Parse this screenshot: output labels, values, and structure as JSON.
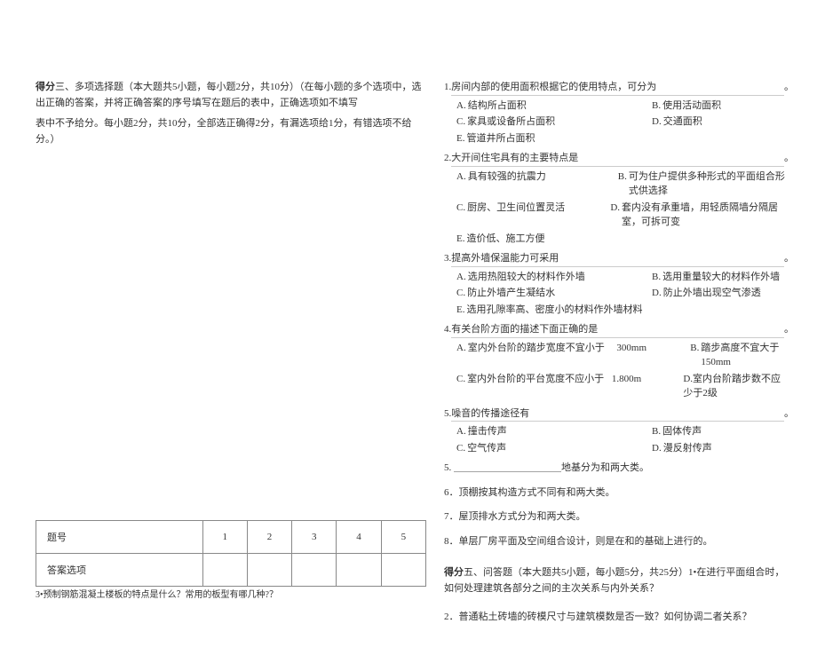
{
  "leftSection": {
    "titlePrefix": "得分",
    "titleRest": "三、多项选择题（本大题共5小题，每小题2分，共10分）（在每小题的多个选项中，选出正确的答案，并将正确答案的序号填写在题后的表中，正确选项如不填写",
    "note": "表中不予给分。每小题2分，共10分，全部选正确得2分，有漏选项给1分，有错选项不给分。）",
    "tableHeader": "题号",
    "cols": [
      "1",
      "2",
      "3",
      "4",
      "5"
    ],
    "tableRowLabel": "答案选项",
    "footnote": "3•预制钢筋混凝土楼板的特点是什么？常用的板型有哪几种?？"
  },
  "questions": [
    {
      "num": "1.",
      "text": "房间内部的使用面积根据它的使用特点，可分为",
      "tail": "。",
      "rows": [
        [
          {
            "l": "A.",
            "t": "结构所占面积",
            "w": "w1"
          },
          {
            "l": "B.",
            "t": "使用活动面积",
            "w": "w3"
          }
        ],
        [
          {
            "l": "C.",
            "t": "家具或设备所占面积",
            "w": "w1"
          },
          {
            "l": "D.",
            "t": "交通面积",
            "w": "w3"
          }
        ],
        [
          {
            "l": "E.",
            "t": "管道井所占面积",
            "w": "w1"
          }
        ]
      ]
    },
    {
      "num": "2.",
      "text": "大开间住宅具有的主要特点是",
      "tail": "。",
      "rows": [
        [
          {
            "l": "A.",
            "t": "具有较强的抗震力",
            "w": "w1"
          },
          {
            "l": "B.",
            "t": "可为住户提供多种形式的平面组合形式供选择",
            "w": ""
          }
        ],
        [
          {
            "l": "C.",
            "t": "厨房、卫生间位置灵活",
            "w": "w1"
          },
          {
            "l": "D.",
            "t": "套内没有承重墙，用轻质隔墙分隔居室，可拆可变",
            "w": ""
          }
        ],
        [
          {
            "l": "E.",
            "t": "造价低、施工方便",
            "w": "w1"
          }
        ]
      ]
    },
    {
      "num": "3.",
      "text": "提高外墙保温能力可采用",
      "tail": "。",
      "rows": [
        [
          {
            "l": "A.",
            "t": "选用热阻较大的材料作外墙",
            "w": "w1"
          },
          {
            "l": "B.",
            "t": "选用重量较大的材料作外墙",
            "w": ""
          }
        ],
        [
          {
            "l": "C.",
            "t": "防止外墙产生凝结水",
            "w": "w1"
          },
          {
            "l": "D.",
            "t": "防止外墙出现空气渗透",
            "w": ""
          }
        ],
        [
          {
            "l": "E.",
            "t": "选用孔隙率高、密度小的材料作外墙材料",
            "w": ""
          }
        ]
      ]
    },
    {
      "num": "4.",
      "text": "有关台阶方面的描述下面正确的是",
      "tail": "。",
      "rows": [
        [
          {
            "l": "A.",
            "t": "室内外台阶的踏步宽度不宜小于",
            "w": "w1"
          },
          {
            "l": "",
            "t": "300mm",
            "w": "w2"
          },
          {
            "l": "B.",
            "t": "踏步高度不宜大于150mm",
            "w": ""
          }
        ],
        [
          {
            "l": "C.",
            "t": "室内外台阶的平台宽度不应小于",
            "w": "w1"
          },
          {
            "l": "",
            "t": "1.800m",
            "w": "w2"
          },
          {
            "l": "",
            "t": "D.室内台阶踏步数不应少于2级",
            "w": ""
          }
        ]
      ]
    },
    {
      "num": "5.",
      "text": "噪音的传播途径有",
      "tail": "。",
      "rows": [
        [
          {
            "l": "A.",
            "t": "撞击传声",
            "w": "w1"
          },
          {
            "l": "B.",
            "t": "固体传声",
            "w": ""
          }
        ],
        [
          {
            "l": "C.",
            "t": "空气传声",
            "w": "w1"
          },
          {
            "l": "D.",
            "t": "漫反射传声",
            "w": ""
          }
        ]
      ]
    }
  ],
  "fill": [
    "5. ＿＿＿＿＿＿＿＿＿＿＿地基分为和两大类。",
    "6．顶棚按其构造方式不同有和两大类。",
    "7．屋顶排水方式分为和两大类。",
    "8．单层厂房平面及空间组合设计，则是在和的基础上进行的。"
  ],
  "essay": {
    "titlePrefix": "得分",
    "titleRest": "五、问答题（本大题共5小题，每小题5分，共25分）1•在进行平面组合时，如何处理建筑各部分之间的主次关系与内外关系？",
    "q2": "2．普通粘土砖墙的砖模尺寸与建筑模数是否一致？如何协调二者关系？"
  }
}
